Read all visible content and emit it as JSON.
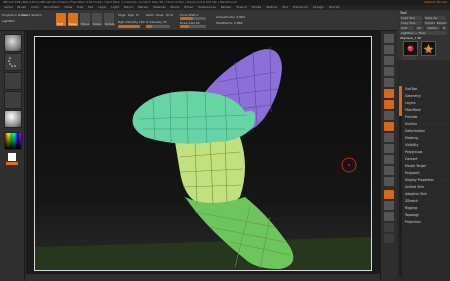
{
  "app": {
    "title": "ZBrush 4R6 [Pierre-Enri] ZBrush Document | Free Mem 4.913+Gb | Used Mem 1.144+Gb | Scratch Disk 48 | Timer 0.001 | PolyCount 0.001 Mp | MeshCount",
    "menu_right": "Default ZScript"
  },
  "menu": {
    "items": [
      "Alpha",
      "Brush",
      "Color",
      "Document",
      "Draw",
      "Edit",
      "File",
      "Layer",
      "Light",
      "Macro",
      "Marker",
      "Material",
      "Movie",
      "Picker",
      "Preferences",
      "Render",
      "Stencil",
      "Stroke",
      "Texture",
      "Tool",
      "Transform",
      "Zplugin",
      "Zscript"
    ]
  },
  "toolbar": {
    "projection_master": "Projection Master",
    "lightbox": "LightBox",
    "quick_sketch": "Quick Sketch",
    "mrgb": "Mrgb",
    "rgb": "Rgb",
    "m": "M",
    "zadd": "Zadd",
    "zsub": "Zsub",
    "zcut": "Zcut",
    "focal_shift": "Focal Shift 0",
    "draw_size": "Draw Size 64",
    "rgb_intensity": "Rgb Intensity 100",
    "z_intensity": "Z Intensity 25",
    "active_points": "ActivePoints: 2,864",
    "total_points": "TotalPoints: 2,864",
    "edit": "Edit",
    "draw": "Draw",
    "move": "Move",
    "scale": "Scale",
    "rotate": "Rotate"
  },
  "sliders": {
    "focal_shift": 0.5,
    "draw_size": 0.35,
    "rgb_intensity": 1.0,
    "z_intensity": 0.25
  },
  "palette": {
    "title": "Tool",
    "load_tool": "Load Tool",
    "save_as": "Save As",
    "copy_tool": "Copy Tool",
    "import": "Import",
    "export": "Export",
    "goz": "GoZ",
    "all": "All",
    "visible": "Visible",
    "r": "R",
    "lightbox_tools": "Lightbox > Tools",
    "current_tool": "ZSphere_1 48",
    "items": [
      "SubTool",
      "Geometry",
      "Layers",
      "FiberMesh",
      "Preview",
      "Surface",
      "Deformation",
      "Masking",
      "Visibility",
      "Polygroups",
      "Contact",
      "Morph Target",
      "Polypaint",
      "Display Properties",
      "Unified Skin",
      "Adaptive Skin",
      "ZSketch",
      "Rigging",
      "Topology",
      "Projection"
    ]
  },
  "colors": {
    "accent": "#e0701a",
    "lavender": "#8c6fd8",
    "mint": "#66d4a4",
    "lime": "#bfe07a",
    "green": "#68c85c"
  }
}
